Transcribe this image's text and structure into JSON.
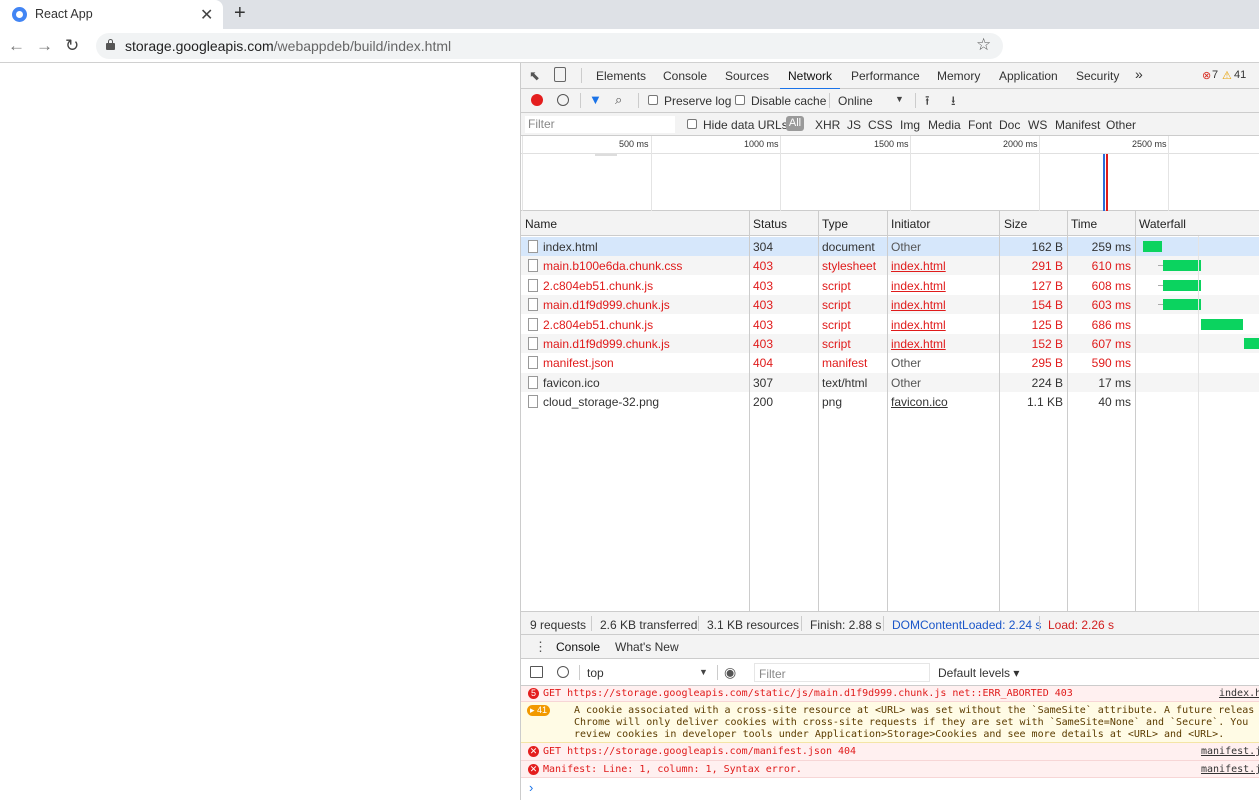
{
  "browser": {
    "tab_title": "React App",
    "url_host": "storage.googleapis.com",
    "url_path": "/webappdeb/build/index.html"
  },
  "devtools": {
    "tabs": [
      "Elements",
      "Console",
      "Sources",
      "Network",
      "Performance",
      "Memory",
      "Application",
      "Security"
    ],
    "more_tabs": "»",
    "error_count": "7",
    "warning_count": "41",
    "network_toolbar": {
      "preserve_log": "Preserve log",
      "disable_cache": "Disable cache",
      "throttle": "Online"
    },
    "filter": {
      "placeholder": "Filter",
      "hide_data_urls": "Hide data URLs",
      "all": "All",
      "types": [
        "XHR",
        "JS",
        "CSS",
        "Img",
        "Media",
        "Font",
        "Doc",
        "WS",
        "Manifest",
        "Other"
      ]
    },
    "overview_ticks": [
      "500 ms",
      "1000 ms",
      "1500 ms",
      "2000 ms",
      "2500 ms"
    ],
    "columns": [
      "Name",
      "Status",
      "Type",
      "Initiator",
      "Size",
      "Time",
      "Waterfall"
    ],
    "requests": [
      {
        "name": "index.html",
        "status": "304",
        "type": "document",
        "initiator": "Other",
        "size": "162 B",
        "time": "259 ms",
        "error": false,
        "initiator_link": false,
        "wf_start": 0.03,
        "wf_len": 0.16,
        "wf_wait": 0
      },
      {
        "name": "main.b100e6da.chunk.css",
        "status": "403",
        "type": "stylesheet",
        "initiator": "index.html",
        "size": "291 B",
        "time": "610 ms",
        "error": true,
        "initiator_link": true,
        "wf_start": 0.2,
        "wf_len": 0.31,
        "wf_wait": 0.04
      },
      {
        "name": "2.c804eb51.chunk.js",
        "status": "403",
        "type": "script",
        "initiator": "index.html",
        "size": "127 B",
        "time": "608 ms",
        "error": true,
        "initiator_link": true,
        "wf_start": 0.2,
        "wf_len": 0.31,
        "wf_wait": 0.04
      },
      {
        "name": "main.d1f9d999.chunk.js",
        "status": "403",
        "type": "script",
        "initiator": "index.html",
        "size": "154 B",
        "time": "603 ms",
        "error": true,
        "initiator_link": true,
        "wf_start": 0.2,
        "wf_len": 0.31,
        "wf_wait": 0.04
      },
      {
        "name": "2.c804eb51.chunk.js",
        "status": "403",
        "type": "script",
        "initiator": "index.html",
        "size": "125 B",
        "time": "686 ms",
        "error": true,
        "initiator_link": true,
        "wf_start": 0.51,
        "wf_len": 0.35,
        "wf_wait": 0
      },
      {
        "name": "main.d1f9d999.chunk.js",
        "status": "403",
        "type": "script",
        "initiator": "index.html",
        "size": "152 B",
        "time": "607 ms",
        "error": true,
        "initiator_link": true,
        "wf_start": 0.87,
        "wf_len": 0.13,
        "wf_wait": 0
      },
      {
        "name": "manifest.json",
        "status": "404",
        "type": "manifest",
        "initiator": "Other",
        "size": "295 B",
        "time": "590 ms",
        "error": true,
        "initiator_link": false,
        "wf_start": 0,
        "wf_len": 0,
        "wf_wait": 0
      },
      {
        "name": "favicon.ico",
        "status": "307",
        "type": "text/html",
        "initiator": "Other",
        "size": "224 B",
        "time": "17 ms",
        "error": false,
        "initiator_link": false,
        "wf_start": 0,
        "wf_len": 0,
        "wf_wait": 0
      },
      {
        "name": "cloud_storage-32.png",
        "status": "200",
        "type": "png",
        "initiator": "favicon.ico",
        "size": "1.1 KB",
        "time": "40 ms",
        "error": false,
        "initiator_link": true,
        "wf_start": 0,
        "wf_len": 0,
        "wf_wait": 0
      }
    ],
    "summary": {
      "requests": "9 requests",
      "transferred": "2.6 KB transferred",
      "resources": "3.1 KB resources",
      "finish": "Finish: 2.88 s",
      "dom_content_loaded": "DOMContentLoaded: 2.24 s",
      "load": "Load: 2.26 s"
    },
    "drawer": {
      "tabs": [
        "Console",
        "What's New"
      ],
      "context": "top",
      "filter_placeholder": "Filter",
      "levels": "Default levels ▾"
    },
    "console_messages": [
      {
        "level": "error",
        "badge": "5",
        "text": "GET https://storage.googleapis.com/static/js/main.d1f9d999.chunk.js net::ERR_ABORTED 403",
        "source": "index.h"
      },
      {
        "level": "warning",
        "badge": "▸ 41",
        "lines": [
          "A cookie associated with a cross-site resource at <URL> was set without the `SameSite` attribute. A future releas",
          "Chrome will only deliver cookies with cross-site requests if they are set with `SameSite=None` and `Secure`. You",
          "review cookies in developer tools under Application>Storage>Cookies and see more details at <URL> and <URL>."
        ]
      },
      {
        "level": "error",
        "badge": "✕",
        "text": "GET https://storage.googleapis.com/manifest.json 404",
        "source": "manifest.j"
      },
      {
        "level": "error",
        "badge": "✕",
        "text": "Manifest: Line: 1, column: 1, Syntax error.",
        "source": "manifest.j"
      }
    ],
    "prompt": "›"
  }
}
